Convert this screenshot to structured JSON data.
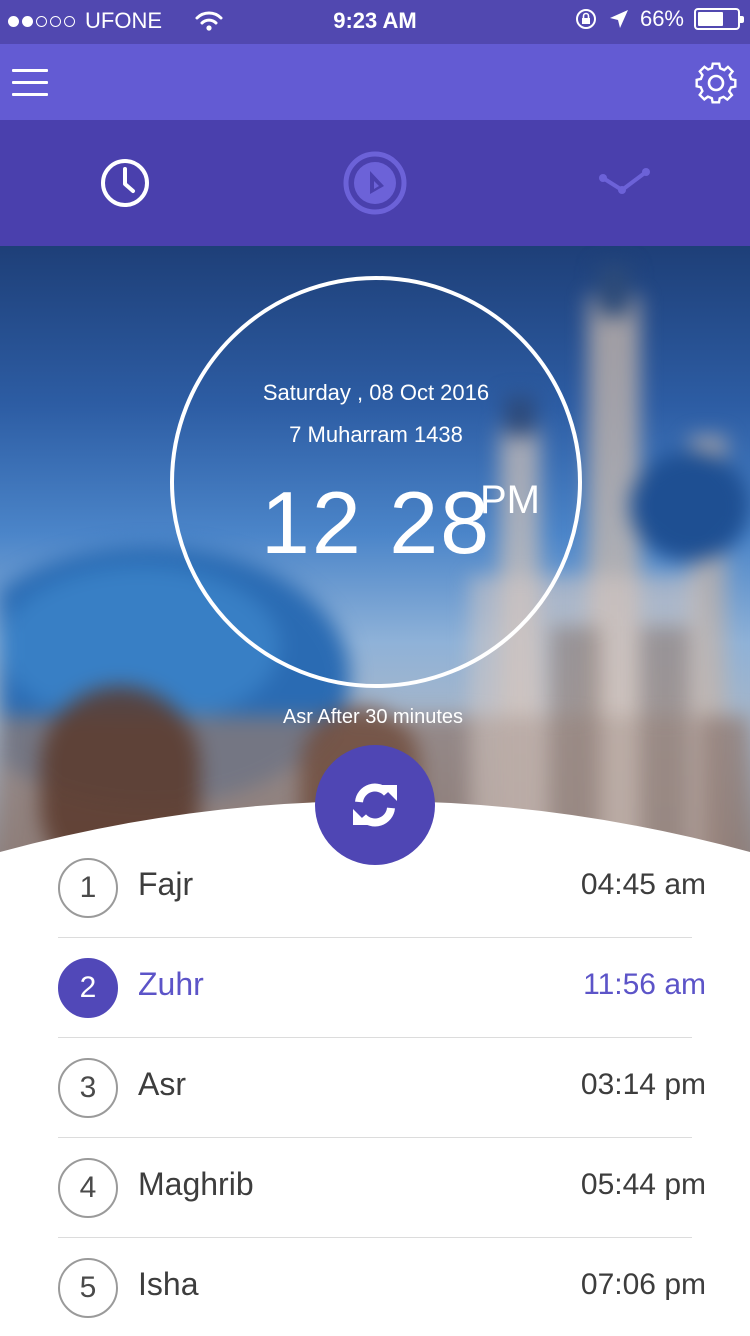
{
  "status_bar": {
    "carrier": "UFONE",
    "time": "9:23 AM",
    "battery": "66%",
    "battery_level": 0.66,
    "signal_bars_filled": 2,
    "signal_bars_total": 5
  },
  "header": {
    "menu_icon": "hamburger-menu-icon",
    "settings_icon": "gear-icon"
  },
  "tabs": [
    {
      "icon": "clock-icon",
      "active": true
    },
    {
      "icon": "compass-icon",
      "active": false
    },
    {
      "icon": "chart-line-icon",
      "active": false
    }
  ],
  "clock": {
    "gregorian_date": "Saturday , 08 Oct 2016",
    "hijri_date": "7 Muharram 1438",
    "time": "12 28",
    "ampm": "PM"
  },
  "next_prayer": "Asr After  30 minutes",
  "refresh_icon": "refresh-icon",
  "prayers": [
    {
      "number": "1",
      "name": "Fajr",
      "time": "04:45 am",
      "active": false
    },
    {
      "number": "2",
      "name": "Zuhr",
      "time": "11:56 am",
      "active": true
    },
    {
      "number": "3",
      "name": "Asr",
      "time": "03:14 pm",
      "active": false
    },
    {
      "number": "4",
      "name": "Maghrib",
      "time": "05:44 pm",
      "active": false
    },
    {
      "number": "5",
      "name": "Isha",
      "time": "07:06 pm",
      "active": false
    }
  ],
  "colors": {
    "primary": "#635bd3",
    "primary_dark": "#4a40ad",
    "accent": "#5148b8",
    "active_text": "#5c54c8"
  }
}
